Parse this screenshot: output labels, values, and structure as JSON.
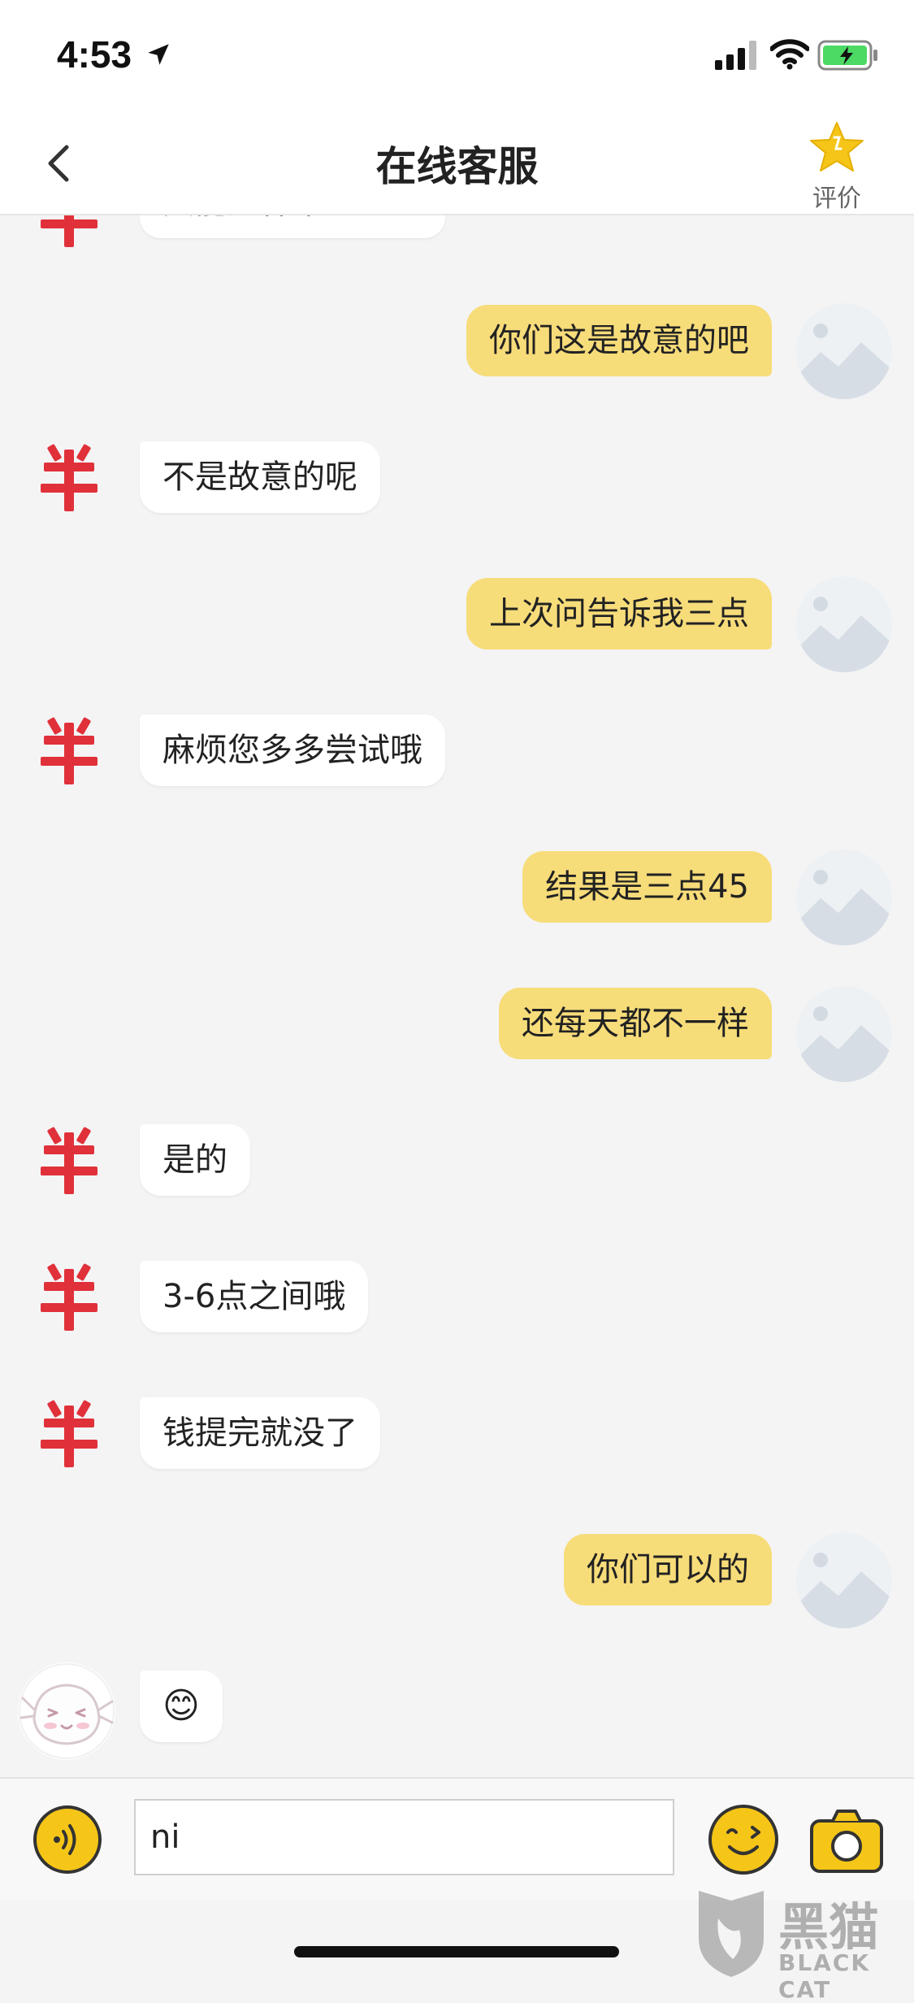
{
  "status_bar": {
    "time": "4:53"
  },
  "nav": {
    "title": "在线客服",
    "rate_label": "评价"
  },
  "messages": [
    {
      "from": "agent",
      "text": "只能这样帮到您的"
    },
    {
      "from": "user",
      "text": "你们这是故意的吧"
    },
    {
      "from": "agent",
      "text": "不是故意的呢"
    },
    {
      "from": "user",
      "text": "上次问告诉我三点"
    },
    {
      "from": "agent",
      "text": "麻烦您多多尝试哦"
    },
    {
      "from": "user",
      "text": "结果是三点45"
    },
    {
      "from": "user",
      "text": "还每天都不一样"
    },
    {
      "from": "agent",
      "text": "是的"
    },
    {
      "from": "agent",
      "text": "3-6点之间哦"
    },
    {
      "from": "agent",
      "text": "钱提完就没了"
    },
    {
      "from": "user",
      "text": "你们可以的"
    },
    {
      "from": "bot",
      "text": "😊"
    }
  ],
  "user_avatar_placeholder": "暂时无法查看",
  "input": {
    "value": "ni"
  },
  "watermark": {
    "text": "黑猫",
    "sub": "BLACK CAT"
  },
  "colors": {
    "user_bubble": "#f7dc7a",
    "agent_avatar": "#e0313a",
    "accent": "#f5c518"
  }
}
